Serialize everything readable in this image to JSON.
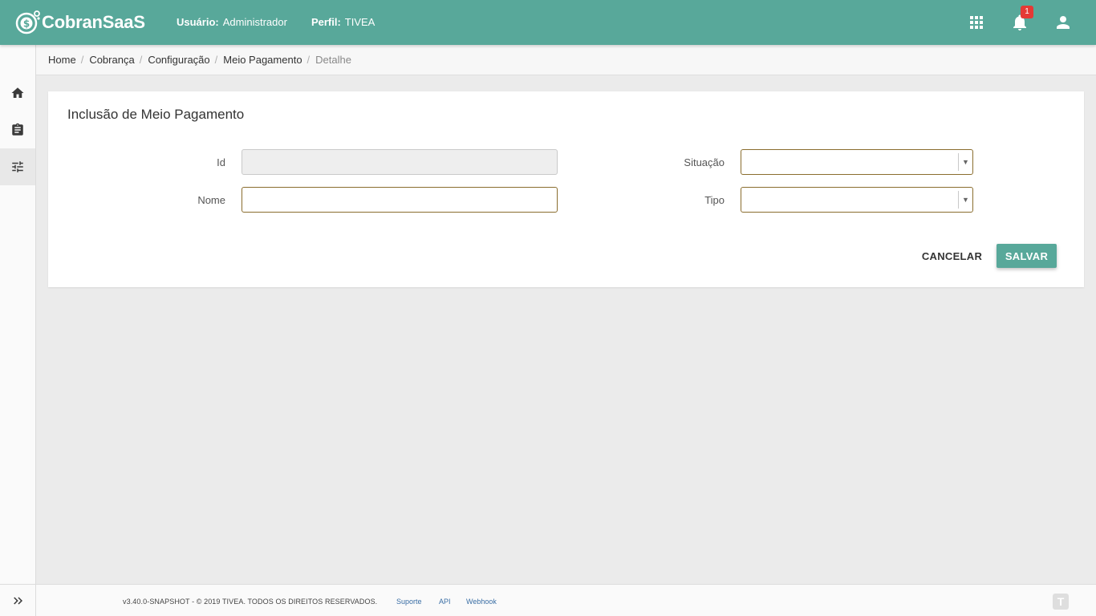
{
  "header": {
    "brand": "CobranSaaS",
    "user_label": "Usuário:",
    "user_value": "Administrador",
    "profile_label": "Perfil:",
    "profile_value": "TIVEA",
    "notification_count": "1",
    "icons": [
      "apps-grid-icon",
      "bell-icon",
      "user-icon"
    ]
  },
  "sidebar": {
    "items": [
      {
        "name": "home",
        "icon": "home-icon"
      },
      {
        "name": "cobranca",
        "icon": "clipboard-icon"
      },
      {
        "name": "configuracao",
        "icon": "settings-sliders-icon",
        "active": true
      }
    ],
    "expand_icon": "double-chevron-right-icon"
  },
  "breadcrumb": {
    "items": [
      "Home",
      "Cobrança",
      "Configuração",
      "Meio Pagamento"
    ],
    "current": "Detalhe"
  },
  "form": {
    "title": "Inclusão de Meio Pagamento",
    "fields": {
      "id": {
        "label": "Id",
        "value": ""
      },
      "nome": {
        "label": "Nome",
        "value": ""
      },
      "situacao": {
        "label": "Situação",
        "value": ""
      },
      "tipo": {
        "label": "Tipo",
        "value": ""
      }
    },
    "cancel_label": "CANCELAR",
    "save_label": "SALVAR"
  },
  "footer": {
    "copyright": "v3.40.0-SNAPSHOT - © 2019 TIVEA. TODOS OS DIREITOS RESERVADOS.",
    "links": [
      "Suporte",
      "API",
      "Webhook"
    ]
  },
  "colors": {
    "primary": "#58a89a",
    "input_border": "#8a6d2e",
    "badge": "#e53935",
    "link": "#3a6ea5"
  }
}
